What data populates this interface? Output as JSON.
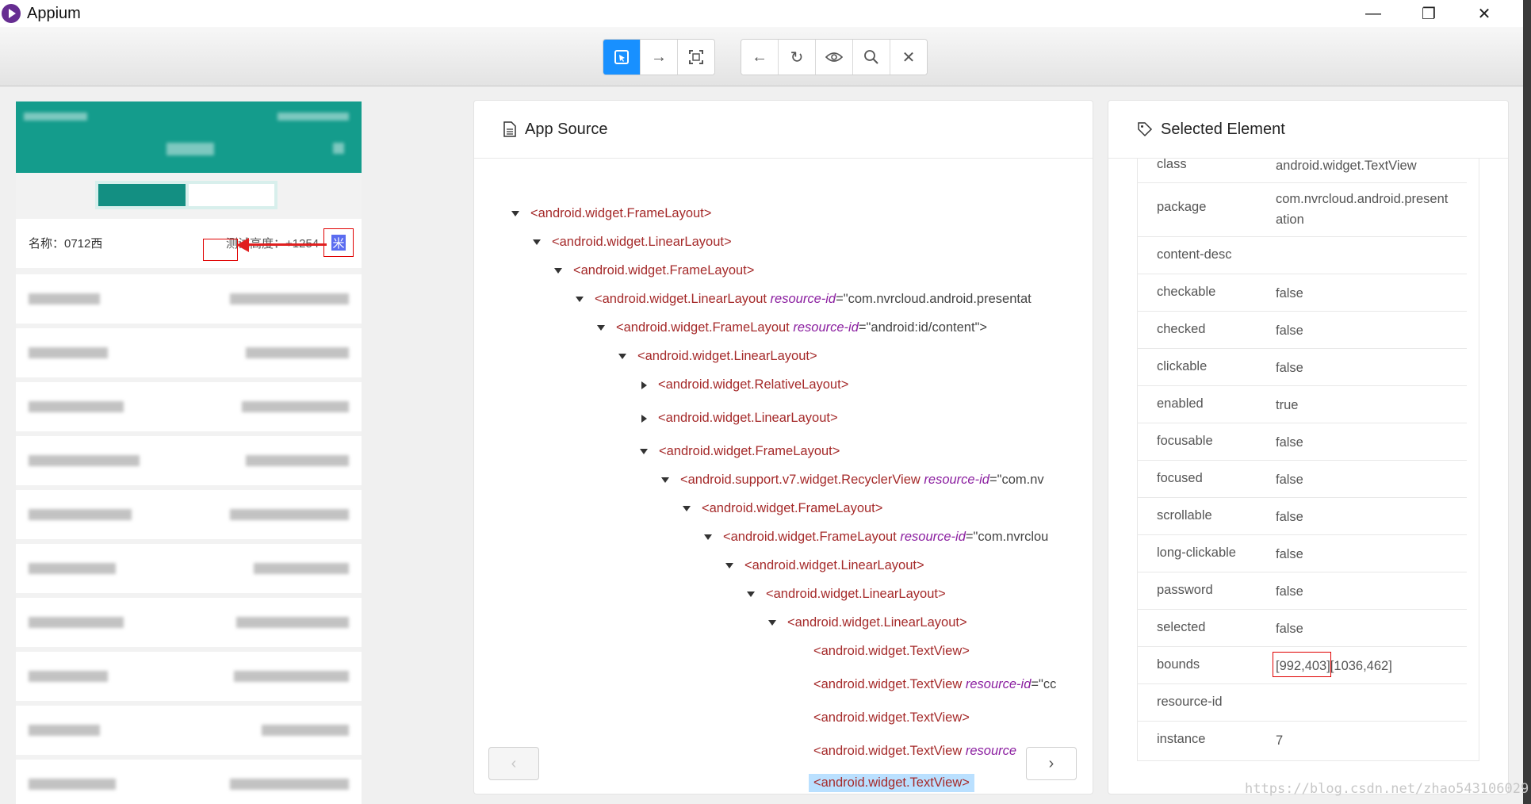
{
  "window": {
    "title": "Appium",
    "minimize": "—",
    "restore": "❐",
    "close": "✕"
  },
  "toolbar": {
    "select_icon": "⬚",
    "swipe_icon": "→",
    "tap_icon": "⛶",
    "back_icon": "←",
    "refresh_icon": "↻",
    "show_icon": "◉",
    "search_icon": "⌕",
    "quit_icon": "✕"
  },
  "device": {
    "row_label": "名称：0712西",
    "row_right": "测试高度：+1254",
    "highlight_char": "米"
  },
  "source_panel": {
    "title": "App Source",
    "nodes": [
      {
        "tag": "<android.widget.FrameLayout>",
        "caret": "down"
      },
      {
        "tag": "<android.widget.LinearLayout>",
        "caret": "down"
      },
      {
        "tag": "<android.widget.FrameLayout>",
        "caret": "down"
      },
      {
        "tag": "<android.widget.LinearLayout ",
        "attr": "resource-id",
        "eq": "=",
        "val": "\"com.nvrcloud.android.presentat",
        "caret": "down"
      },
      {
        "tag": "<android.widget.FrameLayout ",
        "attr": "resource-id",
        "eq": "=",
        "val": "\"android:id/content\">",
        "caret": "down"
      },
      {
        "tag": "<android.widget.LinearLayout>",
        "caret": "down"
      },
      {
        "tag": "<android.widget.RelativeLayout>",
        "caret": "right"
      },
      {
        "tag": "<android.widget.LinearLayout>",
        "caret": "right"
      },
      {
        "tag": "<android.widget.FrameLayout>",
        "caret": "down"
      },
      {
        "tag": "<android.support.v7.widget.RecyclerView ",
        "attr": "resource-id",
        "eq": "=",
        "val": "\"com.nv",
        "caret": "down"
      },
      {
        "tag": "<android.widget.FrameLayout>",
        "caret": "down"
      },
      {
        "tag": "<android.widget.FrameLayout ",
        "attr": "resource-id",
        "eq": "=",
        "val": "\"com.nvrclou",
        "caret": "down"
      },
      {
        "tag": "<android.widget.LinearLayout>",
        "caret": "down"
      },
      {
        "tag": "<android.widget.LinearLayout>",
        "caret": "down"
      },
      {
        "tag": "<android.widget.LinearLayout>",
        "caret": "down"
      },
      {
        "tag": "<android.widget.TextView>",
        "caret": "none"
      },
      {
        "tag": "<android.widget.TextView ",
        "attr": "resource-id",
        "eq": "=",
        "val": "\"cc",
        "caret": "none"
      },
      {
        "tag": "<android.widget.TextView>",
        "caret": "none"
      },
      {
        "tag": "<android.widget.TextView ",
        "attr": "resource",
        "eq": "",
        "val": "",
        "caret": "none"
      },
      {
        "tag": "<android.widget.TextView>",
        "caret": "none"
      }
    ],
    "prev": "‹",
    "next": "›"
  },
  "selected_panel": {
    "title": "Selected Element",
    "attributes": [
      {
        "k": "class",
        "v": "android.widget.TextView"
      },
      {
        "k": "package",
        "v": "com.nvrcloud.android.presentation"
      },
      {
        "k": "content-desc",
        "v": ""
      },
      {
        "k": "checkable",
        "v": "false"
      },
      {
        "k": "checked",
        "v": "false"
      },
      {
        "k": "clickable",
        "v": "false"
      },
      {
        "k": "enabled",
        "v": "true"
      },
      {
        "k": "focusable",
        "v": "false"
      },
      {
        "k": "focused",
        "v": "false"
      },
      {
        "k": "scrollable",
        "v": "false"
      },
      {
        "k": "long-clickable",
        "v": "false"
      },
      {
        "k": "password",
        "v": "false"
      },
      {
        "k": "selected",
        "v": "false"
      },
      {
        "k": "bounds",
        "v": "[992,403][1036,462]"
      },
      {
        "k": "resource-id",
        "v": ""
      },
      {
        "k": "instance",
        "v": "7"
      }
    ]
  },
  "watermark": "https://blog.csdn.net/zhao543106029",
  "colors": {
    "accent": "#1890ff",
    "tag": "#a52a2a",
    "attr_name": "#8b1fa0",
    "device_header": "#149c8c",
    "highlight": "#e00000"
  }
}
